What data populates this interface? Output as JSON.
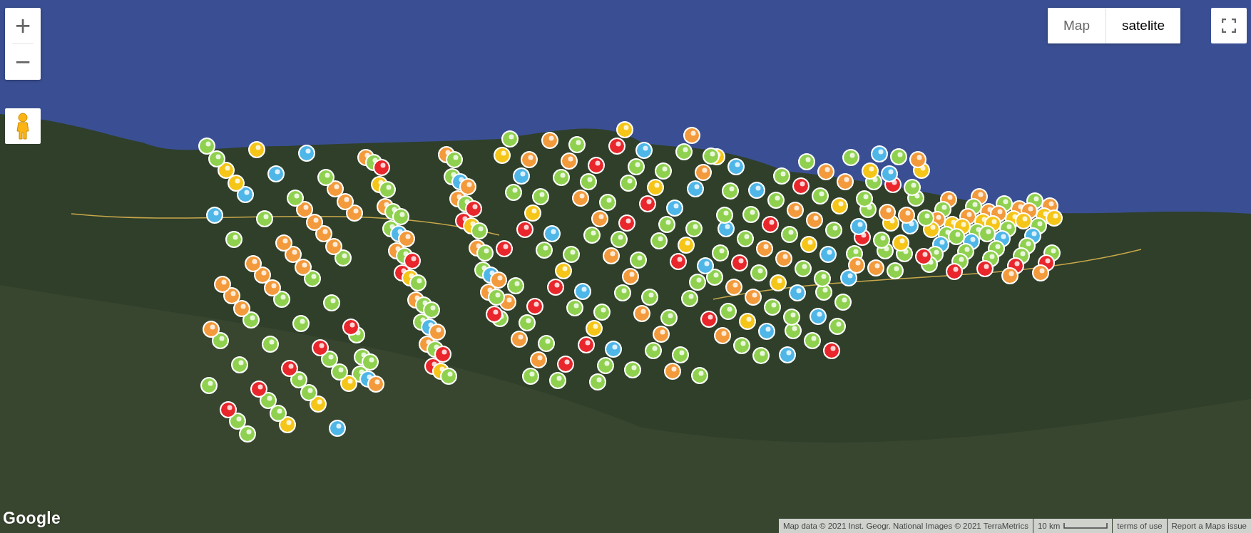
{
  "zoom_controls": {
    "zoom_in": "+",
    "zoom_out": "−"
  },
  "map_type": [
    {
      "label": "Map",
      "selected": false
    },
    {
      "label": "satelite",
      "selected": true
    }
  ],
  "logo": "Google",
  "attribution": {
    "map_data": "Map data © 2021 Inst. Geogr. National Images © 2021 TerraMetrics",
    "scale": "10 km",
    "terms": "terms of use",
    "report": "Report a Maps issue"
  }
}
